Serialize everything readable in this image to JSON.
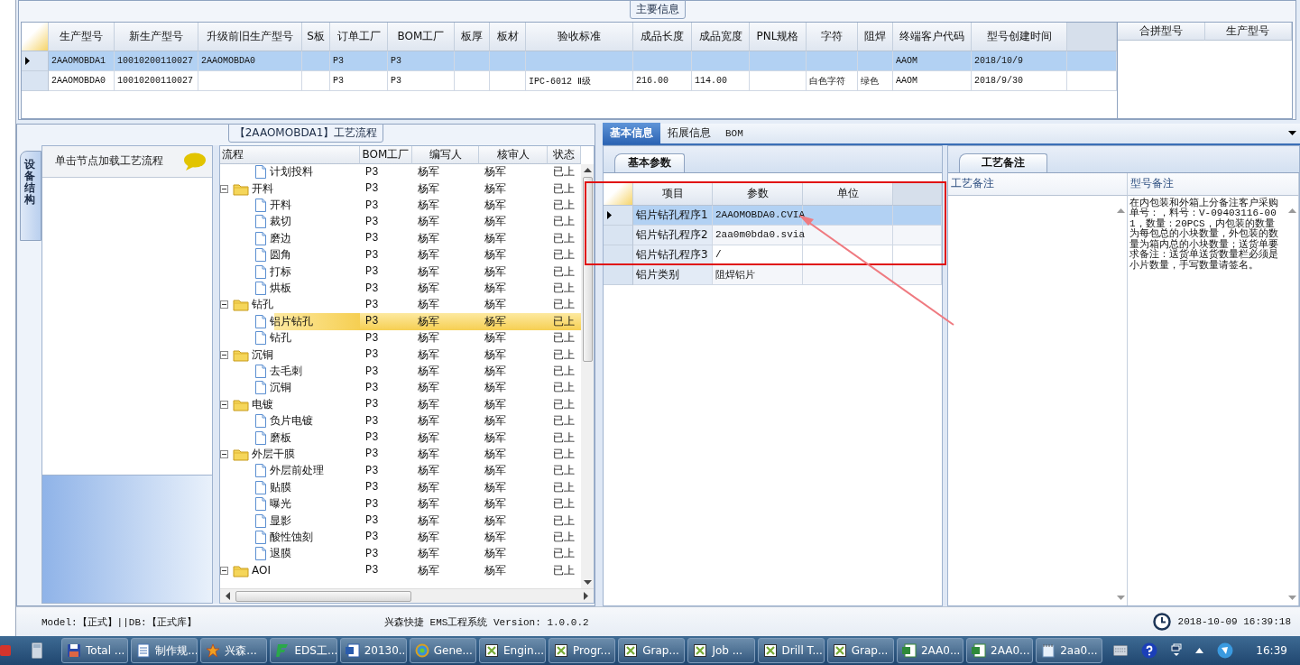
{
  "main_info": {
    "title": "主要信息",
    "columns": [
      "生产型号",
      "新生产型号",
      "升级前旧生产型号",
      "S板",
      "订单工厂",
      "BOM工厂",
      "板厚",
      "板材",
      "验收标准",
      "成品长度",
      "成品宽度",
      "PNL规格",
      "字符",
      "阻焊",
      "终端客户代码",
      "型号创建时间"
    ],
    "rows": [
      {
        "selected": true,
        "cells": [
          "2AAOMOBDA1",
          "10010200110027",
          "2AAOMOBDA0",
          null,
          "P3",
          "P3",
          null,
          null,
          null,
          null,
          null,
          null,
          null,
          null,
          "AAOM",
          "2018/10/9"
        ]
      },
      {
        "selected": false,
        "cells": [
          "2AAOMOBDA0",
          "10010200110027",
          null,
          null,
          "P3",
          "P3",
          null,
          null,
          "IPC-6012 Ⅱ级",
          "216.00",
          "114.00",
          null,
          "白色字符",
          "绿色",
          "AAOM",
          "2018/9/30"
        ]
      }
    ]
  },
  "merge_table": {
    "columns": [
      "合拼型号",
      "生产型号"
    ]
  },
  "process_panel": {
    "title": "【2AAOMOBDA1】工艺流程",
    "side_tab": "设备结构",
    "hint": "单击节点加载工艺流程",
    "columns": [
      "流程",
      "BOM工厂",
      "编写人",
      "核审人",
      "状态"
    ],
    "tree": [
      {
        "children": [
          {
            "kind": "file",
            "name": "计划投料",
            "bom": "P3",
            "writer": "杨军",
            "reviewer": "杨军",
            "status": "已上",
            "selected": false
          }
        ]
      },
      {
        "kind": "folder",
        "name": "开料",
        "bom": "P3",
        "writer": "杨军",
        "reviewer": "杨军",
        "status": "已上",
        "selected": false,
        "expanded": true,
        "children": [
          {
            "kind": "file",
            "name": "开料",
            "bom": "P3",
            "writer": "杨军",
            "reviewer": "杨军",
            "status": "已上",
            "selected": false
          },
          {
            "kind": "file",
            "name": "裁切",
            "bom": "P3",
            "writer": "杨军",
            "reviewer": "杨军",
            "status": "已上",
            "selected": false
          },
          {
            "kind": "file",
            "name": "磨边",
            "bom": "P3",
            "writer": "杨军",
            "reviewer": "杨军",
            "status": "已上",
            "selected": false
          },
          {
            "kind": "file",
            "name": "圆角",
            "bom": "P3",
            "writer": "杨军",
            "reviewer": "杨军",
            "status": "已上",
            "selected": false
          },
          {
            "kind": "file",
            "name": "打标",
            "bom": "P3",
            "writer": "杨军",
            "reviewer": "杨军",
            "status": "已上",
            "selected": false
          },
          {
            "kind": "file",
            "name": "烘板",
            "bom": "P3",
            "writer": "杨军",
            "reviewer": "杨军",
            "status": "已上",
            "selected": false
          }
        ]
      },
      {
        "kind": "folder",
        "name": "钻孔",
        "bom": "P3",
        "writer": "杨军",
        "reviewer": "杨军",
        "status": "已上",
        "selected": false,
        "expanded": true,
        "children": [
          {
            "kind": "file",
            "name": "铝片钻孔",
            "bom": "P3",
            "writer": "杨军",
            "reviewer": "杨军",
            "status": "已上",
            "selected": true
          },
          {
            "kind": "file",
            "name": "钻孔",
            "bom": "P3",
            "writer": "杨军",
            "reviewer": "杨军",
            "status": "已上",
            "selected": false
          }
        ]
      },
      {
        "kind": "folder",
        "name": "沉铜",
        "bom": "P3",
        "writer": "杨军",
        "reviewer": "杨军",
        "status": "已上",
        "selected": false,
        "expanded": true,
        "children": [
          {
            "kind": "file",
            "name": "去毛刺",
            "bom": "P3",
            "writer": "杨军",
            "reviewer": "杨军",
            "status": "已上",
            "selected": false
          },
          {
            "kind": "file",
            "name": "沉铜",
            "bom": "P3",
            "writer": "杨军",
            "reviewer": "杨军",
            "status": "已上",
            "selected": false
          }
        ]
      },
      {
        "kind": "folder",
        "name": "电镀",
        "bom": "P3",
        "writer": "杨军",
        "reviewer": "杨军",
        "status": "已上",
        "selected": false,
        "expanded": true,
        "children": [
          {
            "kind": "file",
            "name": "负片电镀",
            "bom": "P3",
            "writer": "杨军",
            "reviewer": "杨军",
            "status": "已上",
            "selected": false
          },
          {
            "kind": "file",
            "name": "磨板",
            "bom": "P3",
            "writer": "杨军",
            "reviewer": "杨军",
            "status": "已上",
            "selected": false
          }
        ]
      },
      {
        "kind": "folder",
        "name": "外层干膜",
        "bom": "P3",
        "writer": "杨军",
        "reviewer": "杨军",
        "status": "已上",
        "selected": false,
        "expanded": true,
        "children": [
          {
            "kind": "file",
            "name": "外层前处理",
            "bom": "P3",
            "writer": "杨军",
            "reviewer": "杨军",
            "status": "已上",
            "selected": false
          },
          {
            "kind": "file",
            "name": "贴膜",
            "bom": "P3",
            "writer": "杨军",
            "reviewer": "杨军",
            "status": "已上",
            "selected": false
          },
          {
            "kind": "file",
            "name": "曝光",
            "bom": "P3",
            "writer": "杨军",
            "reviewer": "杨军",
            "status": "已上",
            "selected": false
          },
          {
            "kind": "file",
            "name": "显影",
            "bom": "P3",
            "writer": "杨军",
            "reviewer": "杨军",
            "status": "已上",
            "selected": false
          },
          {
            "kind": "file",
            "name": "酸性蚀刻",
            "bom": "P3",
            "writer": "杨军",
            "reviewer": "杨军",
            "status": "已上",
            "selected": false
          },
          {
            "kind": "file",
            "name": "退膜",
            "bom": "P3",
            "writer": "杨军",
            "reviewer": "杨军",
            "status": "已上",
            "selected": false
          }
        ]
      },
      {
        "kind": "folder",
        "name": "AOI",
        "bom": "P3",
        "writer": "杨军",
        "reviewer": "杨军",
        "status": "已上",
        "selected": false,
        "expanded": true
      }
    ]
  },
  "detail_tabs": [
    {
      "label": "基本信息",
      "selected": true
    },
    {
      "label": "拓展信息",
      "selected": false
    },
    {
      "label": "BOM",
      "selected": false
    }
  ],
  "basic_params": {
    "tab": "基本参数",
    "columns": [
      "项目",
      "参数",
      "单位"
    ],
    "rows": [
      {
        "item": "铝片钻孔程序1",
        "param": "2AAOMOBDA0.CVIA",
        "selected": true
      },
      {
        "item": "铝片钻孔程序2",
        "param": "2aa0m0bda0.svia",
        "selected": false
      },
      {
        "item": "铝片钻孔程序3",
        "param": "/",
        "selected": false
      },
      {
        "item": "铝片类别",
        "param": "阻焊铝片",
        "selected": false
      }
    ]
  },
  "notes": {
    "tab": "工艺备注",
    "columns": [
      "工艺备注",
      "型号备注"
    ],
    "model_note": "在内包装和外箱上分备注客户采购单号：，料号：V-09403116-001，数量：20PCS，内包装的数量为每包总的小块数量，外包装的数量为箱内总的小块数量；送货单要求备注：送货单送货数量栏必须是小片数量，手写数量请签名。"
  },
  "status_bar": {
    "model": "Model:【正式】||DB:【正式库】",
    "app": "兴森快捷 EMS工程系统 Version: 1.0.0.2",
    "datetime": "2018-10-09 16:39:18"
  },
  "taskbar": {
    "items": [
      {
        "kind": "disk",
        "label": "Total ..."
      },
      {
        "kind": "list",
        "label": "制作规..."
      },
      {
        "kind": "star",
        "label": "兴森..."
      },
      {
        "kind": "green",
        "label": "EDS工..."
      },
      {
        "kind": "word",
        "label": "20130..."
      },
      {
        "kind": "gear",
        "label": "Gene..."
      },
      {
        "kind": "x",
        "label": "Engin..."
      },
      {
        "kind": "x",
        "label": "Progr..."
      },
      {
        "kind": "x",
        "label": "Grap..."
      },
      {
        "kind": "x",
        "label": "Job ..."
      },
      {
        "kind": "x",
        "label": "Drill T..."
      },
      {
        "kind": "x",
        "label": "Grap..."
      },
      {
        "kind": "excel",
        "label": "2AA0..."
      },
      {
        "kind": "excel",
        "label": "2AA0..."
      },
      {
        "kind": "note",
        "label": "2aa0..."
      }
    ],
    "clock": "16:39"
  }
}
